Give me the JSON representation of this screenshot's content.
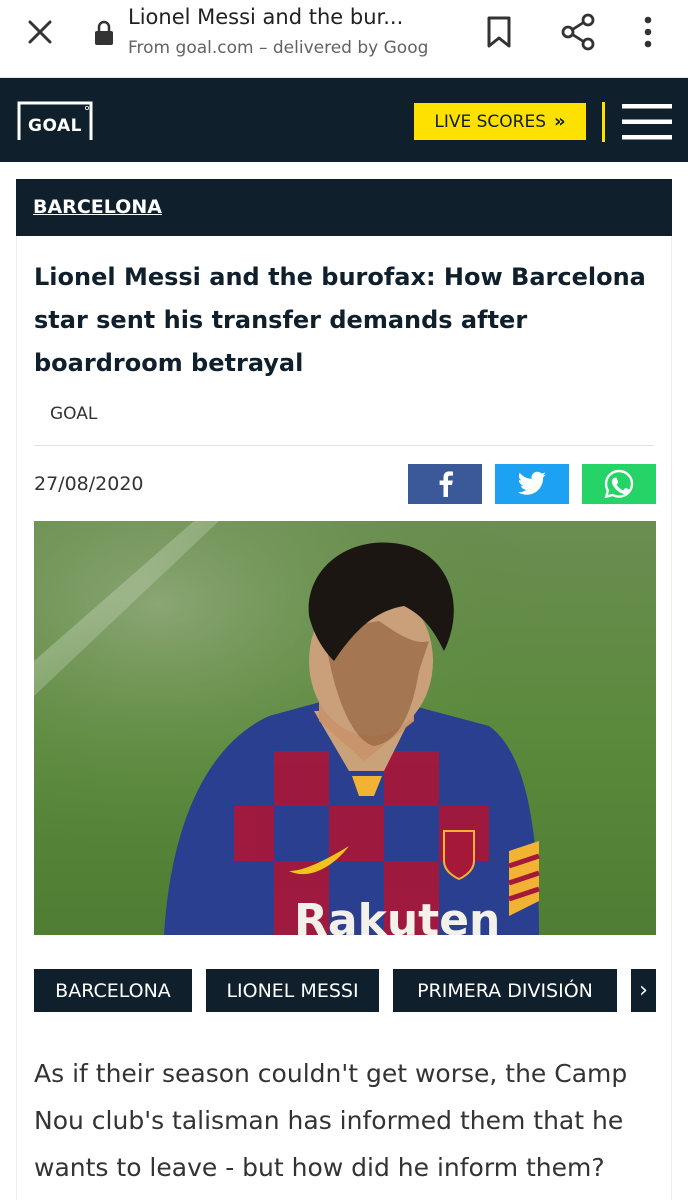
{
  "browser": {
    "title": "Lionel Messi and the bur...",
    "subtitle": "From goal.com – delivered by Goog"
  },
  "site": {
    "logo_text": "GOAL",
    "live_scores_label": "LIVE SCORES",
    "live_scores_chevron": "»"
  },
  "article": {
    "category": "BARCELONA",
    "headline": "Lionel Messi and the burofax: How Barcelona star sent his transfer demands after boardroom betrayal",
    "byline": "GOAL",
    "date": "27/08/2020",
    "share": {
      "facebook": "facebook-icon",
      "twitter": "twitter-icon",
      "whatsapp": "whatsapp-icon"
    },
    "tags": [
      "BARCELONA",
      "LIONEL MESSI",
      "PRIMERA DIVISIÓN"
    ],
    "tags_more": "›",
    "intro": "As if their season couldn't get worse, the Camp Nou club's talisman has informed them that he wants to leave - but how did he inform them?"
  },
  "colors": {
    "brand_navy": "#0f1f2c",
    "brand_yellow": "#ffe100",
    "facebook": "#3b5998",
    "twitter": "#1da1f2",
    "whatsapp": "#25d366"
  }
}
